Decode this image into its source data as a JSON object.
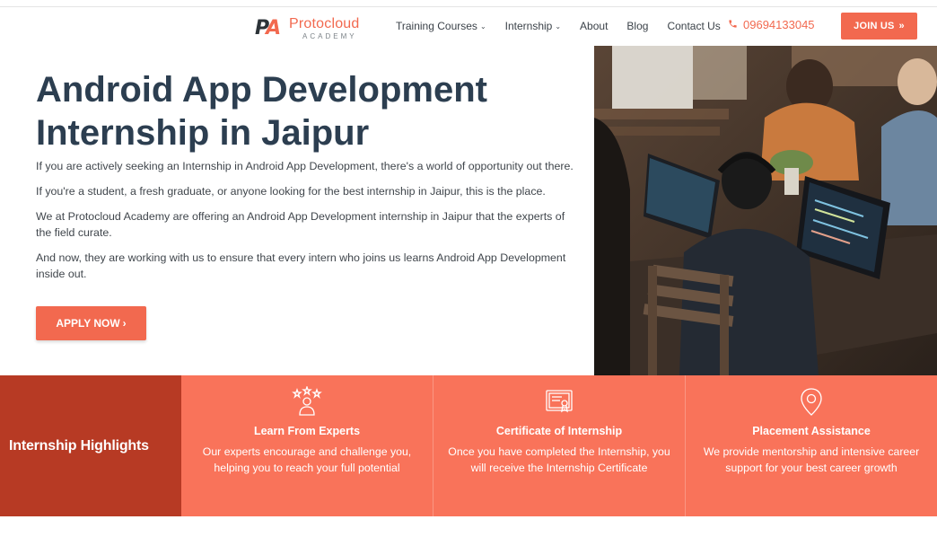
{
  "header": {
    "logo": {
      "mark_p": "P",
      "mark_a": "A",
      "brand": "Protocloud",
      "sub": "ACADEMY"
    },
    "nav": [
      {
        "label": "Training Courses",
        "has_dropdown": true
      },
      {
        "label": "Internship",
        "has_dropdown": true
      },
      {
        "label": "About",
        "has_dropdown": false
      },
      {
        "label": "Blog",
        "has_dropdown": false
      },
      {
        "label": "Contact Us",
        "has_dropdown": false
      }
    ],
    "phone": "09694133045",
    "phone_icon": "phone-icon",
    "join_label": "JOIN US",
    "join_icon": "double-chevron-right-icon"
  },
  "hero": {
    "title_line1": "Android App Development",
    "title_line2": "Internship in Jaipur",
    "paragraphs": [
      "If you are actively seeking an Internship in Android App Development, there's a world of opportunity out there.",
      "If you're a student, a fresh graduate, or anyone looking for the best internship in Jaipur, this is the place.",
      "We at Protocloud Academy are offering an Android App Development internship in Jaipur that the experts of the field curate.",
      "And now, they are working with us to ensure that every intern who joins us learns Android App Development inside out."
    ],
    "apply_label": "APPLY NOW",
    "apply_arrow": "›"
  },
  "highlights": {
    "label": "Internship Highlights",
    "cards": [
      {
        "title": "Learn From Experts",
        "desc": "Our experts encourage and challenge you, helping you to reach your full potential",
        "icon": "expert-stars-icon"
      },
      {
        "title": "Certificate of Internship",
        "desc": "Once you have completed the Internship, you will receive the Internship Certificate",
        "icon": "certificate-icon"
      },
      {
        "title": "Placement Assistance",
        "desc": "We provide mentorship and intensive career support for your best career growth",
        "icon": "location-pin-icon"
      }
    ]
  },
  "colors": {
    "accent": "#f2694f",
    "band": "#f9735a",
    "band_dark": "#b73a24",
    "heading": "#2c3e50"
  }
}
